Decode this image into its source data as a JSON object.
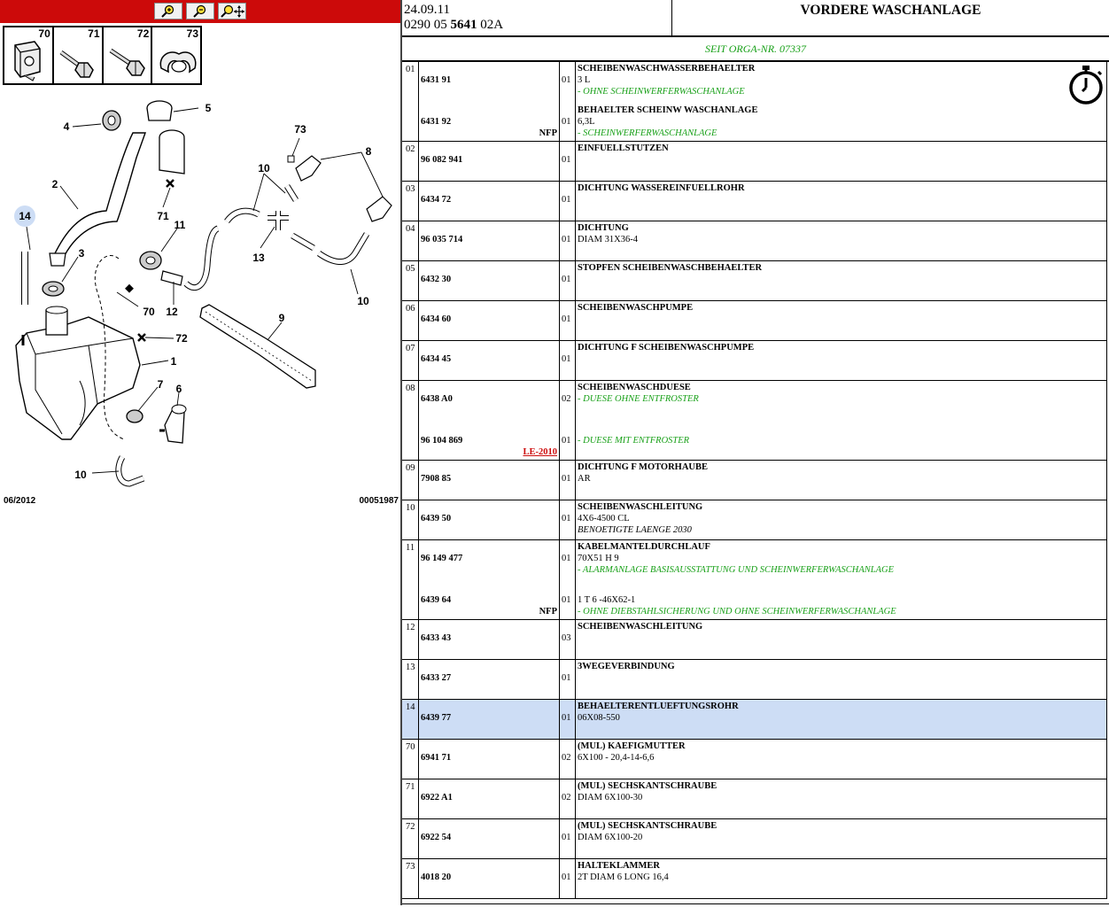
{
  "diagram": {
    "accessories": [
      "70",
      "71",
      "72",
      "73"
    ],
    "callouts": [
      "1",
      "2",
      "3",
      "4",
      "5",
      "6",
      "7",
      "8",
      "9",
      "10",
      "10",
      "10",
      "11",
      "12",
      "13",
      "14",
      "70",
      "71",
      "72",
      "73"
    ],
    "date": "06/2012",
    "drawing_number": "00051987"
  },
  "header": {
    "date": "24.09.11",
    "code_prefix": "0290 05 ",
    "code_bold": "5641",
    "code_suffix": " 02A",
    "title": "VORDERE WASCHANLAGE",
    "subtitle": "SEIT ORGA-NR. 07337"
  },
  "rows": [
    {
      "idx": "01",
      "refs": [
        {
          "ref": "6431 91",
          "qty": "01"
        },
        {
          "ref": "6431 92",
          "tag": "NFP",
          "qty": "01"
        }
      ],
      "blocks": [
        {
          "title": "SCHEIBENWASCHWASSERBEHAELTER",
          "lines": [
            {
              "t": "3 L"
            },
            {
              "t": "- OHNE SCHEINWERFERWASCHANLAGE",
              "c": "green"
            }
          ]
        },
        {
          "title": "BEHAELTER SCHEINW WASCHANLAGE",
          "lines": [
            {
              "t": "6,3L"
            },
            {
              "t": "- SCHEINWERFERWASCHANLAGE",
              "c": "green"
            }
          ]
        }
      ]
    },
    {
      "idx": "02",
      "refs": [
        {
          "ref": "96 082 941",
          "qty": "01"
        }
      ],
      "blocks": [
        {
          "title": "EINFUELLSTUTZEN",
          "lines": []
        }
      ]
    },
    {
      "idx": "03",
      "refs": [
        {
          "ref": "6434 72",
          "qty": "01"
        }
      ],
      "blocks": [
        {
          "title": "DICHTUNG WASSEREINFUELLROHR",
          "lines": []
        }
      ]
    },
    {
      "idx": "04",
      "refs": [
        {
          "ref": "96 035 714",
          "qty": "01"
        }
      ],
      "blocks": [
        {
          "title": "DICHTUNG",
          "lines": [
            {
              "t": "DIAM 31X36-4"
            }
          ]
        }
      ]
    },
    {
      "idx": "05",
      "refs": [
        {
          "ref": "6432 30",
          "qty": "01"
        }
      ],
      "blocks": [
        {
          "title": "STOPFEN SCHEIBENWASCHBEHAELTER",
          "lines": []
        }
      ]
    },
    {
      "idx": "06",
      "refs": [
        {
          "ref": "6434 60",
          "qty": "01"
        }
      ],
      "blocks": [
        {
          "title": "SCHEIBENWASCHPUMPE",
          "lines": []
        }
      ]
    },
    {
      "idx": "07",
      "refs": [
        {
          "ref": "6434 45",
          "qty": "01"
        }
      ],
      "blocks": [
        {
          "title": "DICHTUNG F SCHEIBENWASCHPUMPE",
          "lines": []
        }
      ]
    },
    {
      "idx": "08",
      "refs": [
        {
          "ref": "6438 A0",
          "qty": "02"
        },
        {
          "ref": "96 104 869",
          "tag": "LE-2010",
          "tagc": "red",
          "qty": "01"
        }
      ],
      "blocks": [
        {
          "title": "SCHEIBENWASCHDUESE",
          "lines": [
            {
              "t": "- DUESE OHNE ENTFROSTER",
              "c": "green"
            }
          ]
        },
        {
          "title": "",
          "lines": [
            {
              "t": "- DUESE MIT ENTFROSTER",
              "c": "green"
            }
          ]
        }
      ]
    },
    {
      "idx": "09",
      "refs": [
        {
          "ref": "7908 85",
          "qty": "01"
        }
      ],
      "blocks": [
        {
          "title": "DICHTUNG F MOTORHAUBE",
          "lines": [
            {
              "t": "AR"
            }
          ]
        }
      ]
    },
    {
      "idx": "10",
      "refs": [
        {
          "ref": "6439 50",
          "qty": "01"
        }
      ],
      "blocks": [
        {
          "title": "SCHEIBENWASCHLEITUNG",
          "lines": [
            {
              "t": "4X6-4500 CL"
            },
            {
              "t": "BENOETIGTE LAENGE 2030",
              "c": "note"
            }
          ]
        }
      ]
    },
    {
      "idx": "11",
      "refs": [
        {
          "ref": "96 149 477",
          "qty": "01"
        },
        {
          "ref": "6439 64",
          "tag": "NFP",
          "qty": "01"
        }
      ],
      "blocks": [
        {
          "title": "KABELMANTELDURCHLAUF",
          "lines": [
            {
              "t": "70X51 H 9"
            },
            {
              "t": "- ALARMANLAGE BASISAUSSTATTUNG UND SCHEINWERFERWASCHANLAGE",
              "c": "green"
            }
          ]
        },
        {
          "title": "",
          "lines": [
            {
              "t": "1 T 6 -46X62-1"
            },
            {
              "t": "- OHNE DIEBSTAHLSICHERUNG UND OHNE SCHEINWERFERWASCHANLAGE",
              "c": "green"
            }
          ]
        }
      ]
    },
    {
      "idx": "12",
      "refs": [
        {
          "ref": "6433 43",
          "qty": "03"
        }
      ],
      "blocks": [
        {
          "title": "SCHEIBENWASCHLEITUNG",
          "lines": []
        }
      ]
    },
    {
      "idx": "13",
      "refs": [
        {
          "ref": "6433 27",
          "qty": "01"
        }
      ],
      "blocks": [
        {
          "title": "3WEGEVERBINDUNG",
          "lines": []
        }
      ]
    },
    {
      "idx": "14",
      "highlight": true,
      "refs": [
        {
          "ref": "6439 77",
          "qty": "01"
        }
      ],
      "blocks": [
        {
          "title": "BEHAELTERENTLUEFTUNGSROHR",
          "lines": [
            {
              "t": "06X08-550"
            }
          ]
        }
      ]
    },
    {
      "idx": "70",
      "refs": [
        {
          "ref": "6941 71",
          "qty": "02"
        }
      ],
      "blocks": [
        {
          "title": "(MUL) KAEFIGMUTTER",
          "lines": [
            {
              "t": "6X100 - 20,4-14-6,6"
            }
          ]
        }
      ]
    },
    {
      "idx": "71",
      "refs": [
        {
          "ref": "6922 A1",
          "qty": "02"
        }
      ],
      "blocks": [
        {
          "title": "(MUL) SECHSKANTSCHRAUBE",
          "lines": [
            {
              "t": "DIAM 6X100-30"
            }
          ]
        }
      ]
    },
    {
      "idx": "72",
      "refs": [
        {
          "ref": "6922 54",
          "qty": "01"
        }
      ],
      "blocks": [
        {
          "title": "(MUL) SECHSKANTSCHRAUBE",
          "lines": [
            {
              "t": "DIAM 6X100-20"
            }
          ]
        }
      ]
    },
    {
      "idx": "73",
      "refs": [
        {
          "ref": "4018 20",
          "qty": "01"
        }
      ],
      "blocks": [
        {
          "title": "HALTEKLAMMER",
          "lines": [
            {
              "t": "2T DIAM 6 LONG 16,4"
            }
          ]
        }
      ]
    }
  ]
}
